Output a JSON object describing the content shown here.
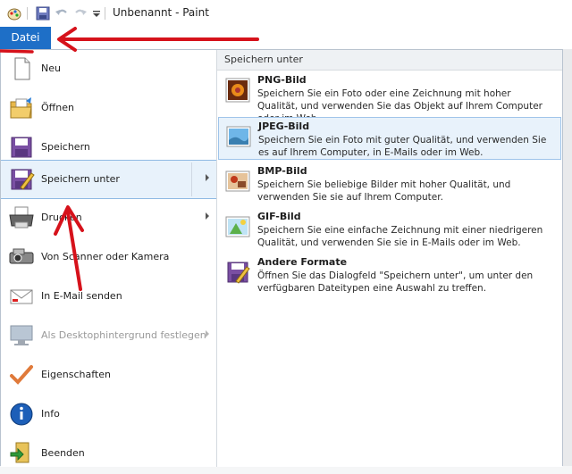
{
  "window": {
    "title": "Unbenannt - Paint"
  },
  "quick_access": {
    "icons": [
      "paint-app-icon",
      "save-icon",
      "undo-icon",
      "redo-icon",
      "customize-dropdown-icon"
    ]
  },
  "ribbon": {
    "file_tab_label": "Datei"
  },
  "file_menu": {
    "items": [
      {
        "label": "Neu",
        "icon": "new-document-icon"
      },
      {
        "label": "Öffnen",
        "icon": "open-folder-icon"
      },
      {
        "label": "Speichern",
        "icon": "save-icon"
      },
      {
        "label": "Speichern unter",
        "icon": "save-as-icon",
        "submenu": true,
        "selected": true
      },
      {
        "label": "Drucken",
        "icon": "printer-icon",
        "submenu": true
      },
      {
        "label": "Von Scanner oder Kamera",
        "icon": "scanner-camera-icon"
      },
      {
        "label": "In E-Mail senden",
        "icon": "email-icon"
      },
      {
        "label": "Als Desktophintergrund festlegen",
        "icon": "desktop-background-icon",
        "submenu": true,
        "disabled": true
      },
      {
        "label": "Eigenschaften",
        "icon": "checkmark-icon"
      },
      {
        "label": "Info",
        "icon": "info-icon"
      },
      {
        "label": "Beenden",
        "icon": "exit-icon"
      }
    ]
  },
  "save_as_panel": {
    "header": "Speichern unter",
    "formats": [
      {
        "name": "PNG-Bild",
        "description": "Speichern Sie ein Foto oder eine Zeichnung mit hoher Qualität, und verwenden Sie das Objekt auf Ihrem Computer oder im Web.",
        "icon": "png-image-icon"
      },
      {
        "name": "JPEG-Bild",
        "description": "Speichern Sie ein Foto mit guter Qualität, und verwenden Sie es auf Ihrem Computer, in E-Mails oder im Web.",
        "icon": "jpeg-image-icon",
        "highlighted": true
      },
      {
        "name": "BMP-Bild",
        "description": "Speichern Sie beliebige Bilder mit hoher Qualität, und verwenden Sie sie auf Ihrem Computer.",
        "icon": "bmp-image-icon"
      },
      {
        "name": "GIF-Bild",
        "description": "Speichern Sie eine einfache Zeichnung mit einer niedrigeren Qualität, und verwenden Sie sie in E-Mails oder im Web.",
        "icon": "gif-image-icon"
      },
      {
        "name": "Andere Formate",
        "description": "Öffnen Sie das Dialogfeld \"Speichern unter\", um unter den verfügbaren Dateitypen eine Auswahl zu treffen.",
        "icon": "other-formats-icon"
      }
    ]
  },
  "colors": {
    "file_tab": "#1e6fc7",
    "annotation": "#d6121b",
    "selection": "#e8f2fb"
  }
}
